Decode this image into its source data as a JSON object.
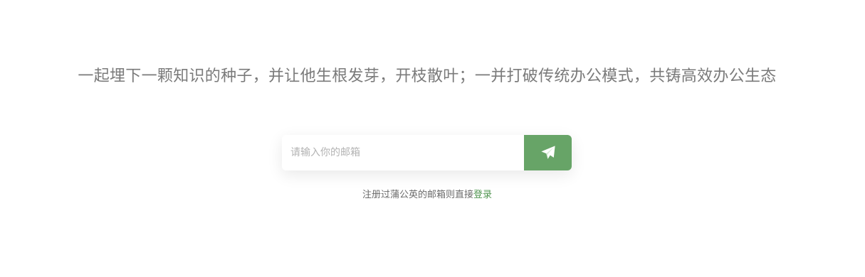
{
  "hero": {
    "tagline": "一起埋下一颗知识的种子，并让他生根发芽，开枝散叶；一并打破传统办公模式，共铸高效办公生态"
  },
  "signup": {
    "email_placeholder": "请输入你的邮箱",
    "email_value": "",
    "send_icon": "paper-plane-icon"
  },
  "hint": {
    "text": "注册过蒲公英的邮箱则直接",
    "login_label": "登录"
  },
  "colors": {
    "accent": "#67a467",
    "link": "#4f944f",
    "tagline": "#7a7a7a"
  }
}
